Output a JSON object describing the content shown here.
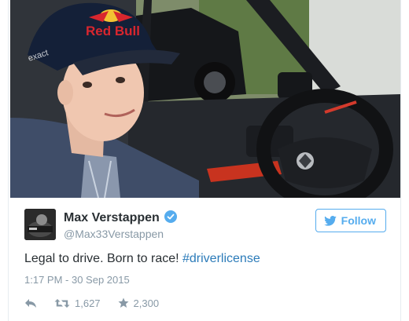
{
  "photo": {
    "description_icon": "photo",
    "cap_text_front": "Red Bull",
    "cap_text_side": "exact"
  },
  "user": {
    "name": "Max Verstappen",
    "handle": "@Max33Verstappen",
    "verified_icon": "verified-badge-icon"
  },
  "follow_button": {
    "label": "Follow",
    "icon": "twitter-bird-icon"
  },
  "tweet": {
    "text": "Legal to drive. Born to race! ",
    "hashtag": "#driverlicense",
    "timestamp": "1:17 PM - 30 Sep 2015"
  },
  "actions": {
    "reply_icon": "reply-icon",
    "retweet_icon": "retweet-icon",
    "retweet_count": "1,627",
    "like_icon": "star-icon",
    "like_count": "2,300"
  },
  "colors": {
    "accent": "#55acee",
    "link": "#2b7bb9",
    "text": "#292f33",
    "muted": "#8899a6",
    "verified": "#55acee"
  }
}
